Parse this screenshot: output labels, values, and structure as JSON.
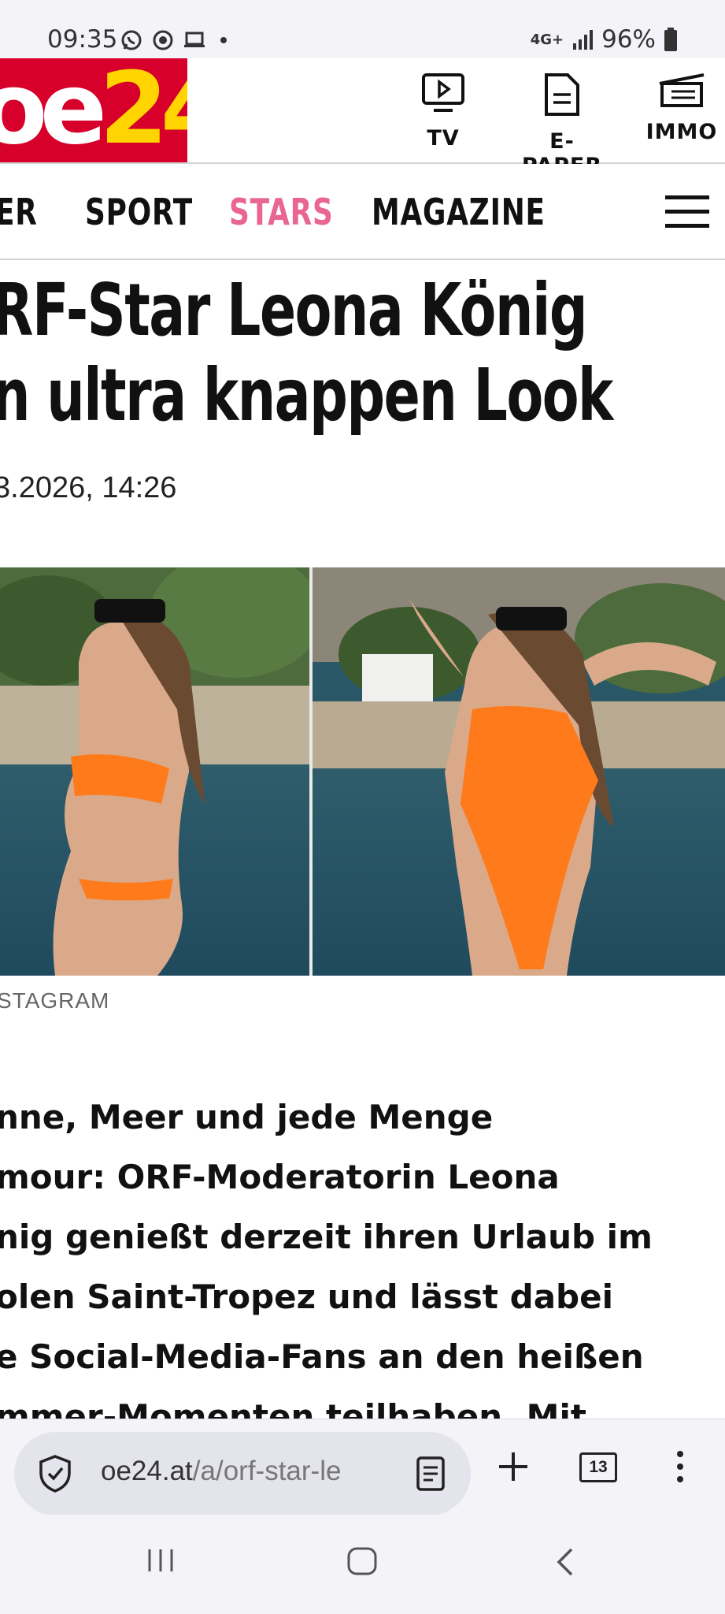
{
  "status_bar": {
    "time": "09:35",
    "network": "4G+",
    "battery": "96%",
    "icons": [
      "whatsapp-icon",
      "app-notification-icon",
      "laptop-icon",
      "dot-icon",
      "signal-icon",
      "battery-icon"
    ]
  },
  "header": {
    "logo": "oe24",
    "brand_color": "#d6002a",
    "logo_accent": "#ffd400",
    "items": [
      {
        "label": "TV",
        "icon": "tv-play-icon"
      },
      {
        "label": "E-PAPER",
        "icon": "document-icon"
      },
      {
        "label": "IMMO",
        "icon": "building-icon"
      }
    ]
  },
  "nav": {
    "items": [
      "ER",
      "SPORT",
      "STARS",
      "MAGAZINE"
    ],
    "active": "STARS",
    "active_color": "#e8668f"
  },
  "article": {
    "headline_lines": [
      "RF-Star Leona König",
      "n ultra knappen Look"
    ],
    "date": "3.2026, 14:26",
    "image_caption": "STAGRAM",
    "lead_lines": [
      "nne, Meer und jede Menge",
      "mour: ORF-Moderatorin Leona",
      "nig genießt derzeit ihren Urlaub im",
      "olen Saint-Tropez und lässt dabei",
      "e Social-Media-Fans an den heißen",
      "mmer-Momenten teilhaben. Mit"
    ]
  },
  "browser": {
    "url_host": "oe24.at",
    "url_path": "/a/orf-star-le",
    "tab_count": "13"
  }
}
